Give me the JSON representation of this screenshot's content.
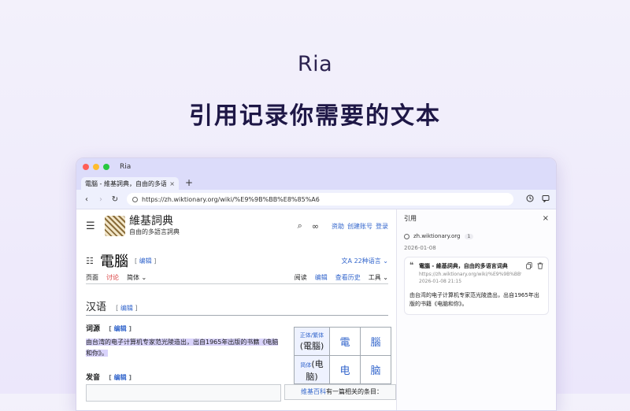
{
  "hero": {
    "title": "Ria",
    "subtitle": "引用记录你需要的文本"
  },
  "window": {
    "app_name": "Ria"
  },
  "tab": {
    "title": "電腦 - 維基詞典，自由的多语言词典",
    "close": "×",
    "new_tab": "+"
  },
  "toolbar": {
    "back": "‹",
    "forward": "›",
    "reload": "↻",
    "url": "https://zh.wiktionary.org/wiki/%E9%9B%BB%E8%85%A6"
  },
  "wiki": {
    "menu_icon": "☰",
    "name": "維基詞典",
    "tagline": "自由的多語言詞典",
    "search_icon": "⌕",
    "infinity_icon": "∞",
    "links": [
      "资助",
      "创建账号",
      "登录"
    ],
    "page_title": "電腦",
    "edit_label": "编辑",
    "lang_button": "22种语言",
    "tabs_left": [
      "页面",
      "讨论",
      "简体 ⌄"
    ],
    "tabs_right": [
      "阅读",
      "编辑",
      "查看历史",
      "工具 ⌄"
    ],
    "section": "汉语",
    "etymology_heading": "词源",
    "etymology_text": "由台湾的电子计算机专家范光陵造出，出自1965年出版的书籍《电脑和你》。",
    "pronunciation_heading": "发音",
    "table": {
      "row1_label": "正体/繁体",
      "row1_word": "(電腦)",
      "row1_c1": "電",
      "row1_c2": "腦",
      "row2_label": "简体",
      "row2_word": "(电脑)",
      "row2_c1": "电",
      "row2_c2": "脑"
    },
    "sister_link": "维基百科",
    "sister_text": "有一篇相关的条目："
  },
  "panel": {
    "title": "引用",
    "close": "×",
    "site": "zh.wiktionary.org",
    "count": "1",
    "date": "2026-01-08",
    "card": {
      "title": "電腦 - 維基詞典，自由的多语言词典",
      "url": "https://zh.wiktionary.org/wiki/%E9%9B%BB%E8%85%A6",
      "time": "2026-01-08 21:15",
      "text": "由台湾的电子计算机专家范光陵造出，出自1965年出版的书籍《电脑和你》。"
    }
  }
}
